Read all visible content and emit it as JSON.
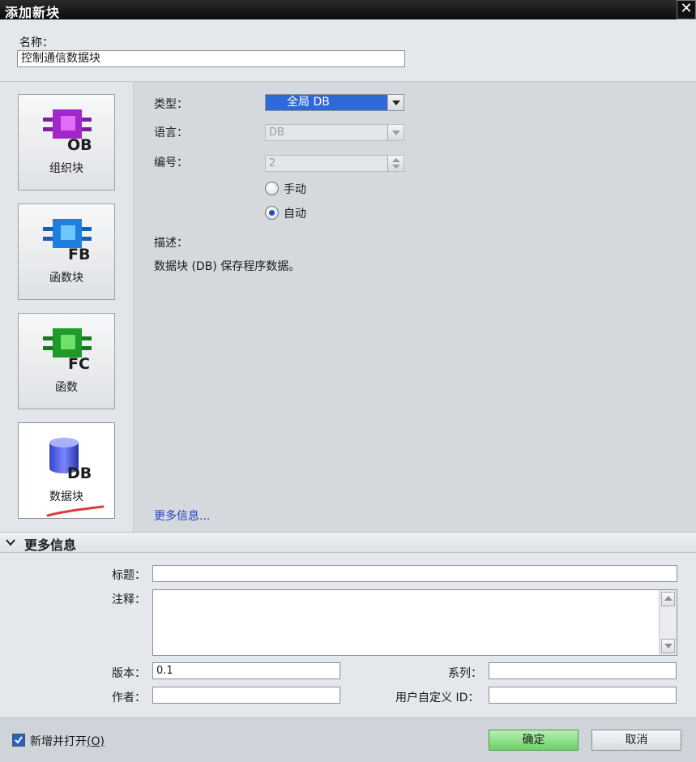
{
  "dialog": {
    "title": "添加新块",
    "close_glyph": "✕"
  },
  "name": {
    "label": "名称：",
    "value": "控制通信数据块"
  },
  "block_types": [
    {
      "id": "ob",
      "label": "组织块",
      "badge": "OB",
      "color": "#c43ee6"
    },
    {
      "id": "fb",
      "label": "函数块",
      "badge": "FB",
      "color": "#2f8ef0"
    },
    {
      "id": "fc",
      "label": "函数",
      "badge": "FC",
      "color": "#25a832"
    },
    {
      "id": "db",
      "label": "数据块",
      "badge": "DB",
      "color": "#5b67e0",
      "selected": true
    }
  ],
  "properties": {
    "type_label": "类型：",
    "type_value": "全局 DB",
    "language_label": "语言：",
    "language_value": "DB",
    "number_label": "编号：",
    "number_value": "2",
    "radio_manual": "手动",
    "radio_auto": "自动",
    "radio_selected": "auto",
    "desc_label": "描述：",
    "desc_text": "数据块 (DB) 保存程序数据。",
    "more_info_link": "更多信息..."
  },
  "more_info": {
    "section_title": "更多信息",
    "title_label": "标题：",
    "title_value": "",
    "comment_label": "注释：",
    "comment_value": "",
    "version_label": "版本：",
    "version_value": "0.1",
    "family_label": "系列：",
    "family_value": "",
    "author_label": "作者：",
    "author_value": "",
    "user_id_label": "用户自定义 ID：",
    "user_id_value": ""
  },
  "footer": {
    "add_open_label": "新增并打开",
    "add_open_mnemonic": "(O)",
    "add_open_checked": true,
    "ok_label": "确定",
    "cancel_label": "取消"
  },
  "colors": {
    "accent": "#2f69d8",
    "ok_button": "#6ccf66",
    "link": "#2340c8",
    "annotation": "#e03a3a"
  }
}
